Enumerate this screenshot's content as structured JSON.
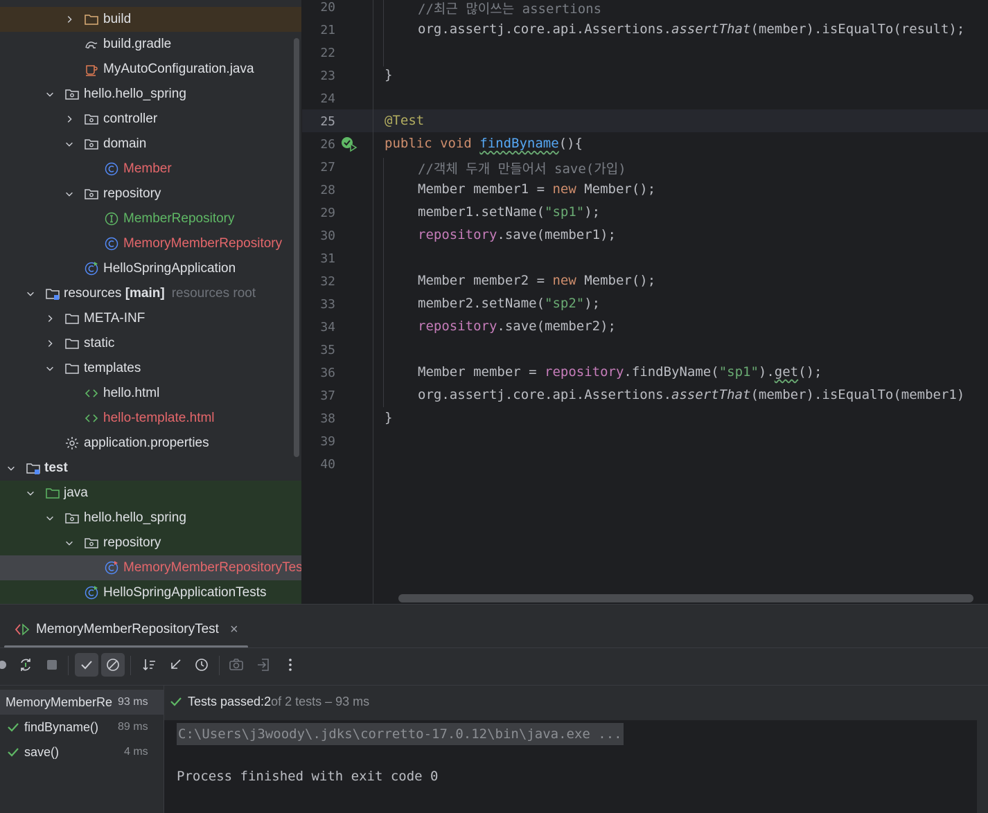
{
  "project_tree": {
    "items": [
      {
        "label": "build",
        "expanded": false
      },
      {
        "label": "build.gradle"
      },
      {
        "label": "MyAutoConfiguration.java"
      },
      {
        "label": "hello.hello_spring",
        "expanded": true
      },
      {
        "label": "controller",
        "expanded": false
      },
      {
        "label": "domain",
        "expanded": true
      },
      {
        "label": "Member"
      },
      {
        "label": "repository",
        "expanded": true
      },
      {
        "label": "MemberRepository"
      },
      {
        "label": "MemoryMemberRepository"
      },
      {
        "label": "HelloSpringApplication"
      },
      {
        "label": "resources",
        "tag": "[main]",
        "hint": "resources root",
        "expanded": true
      },
      {
        "label": "META-INF",
        "expanded": false
      },
      {
        "label": "static",
        "expanded": false
      },
      {
        "label": "templates",
        "expanded": true
      },
      {
        "label": "hello.html"
      },
      {
        "label": "hello-template.html"
      },
      {
        "label": "application.properties"
      },
      {
        "label": "test",
        "expanded": true
      },
      {
        "label": "java",
        "expanded": true
      },
      {
        "label": "hello.hello_spring",
        "expanded": true
      },
      {
        "label": "repository",
        "expanded": true
      },
      {
        "label": "MemoryMemberRepositoryTest",
        "selected": true
      },
      {
        "label": "HelloSpringApplicationTests"
      }
    ]
  },
  "editor": {
    "line_numbers": [
      "20",
      "21",
      "22",
      "23",
      "24",
      "25",
      "26",
      "27",
      "28",
      "29",
      "30",
      "31",
      "32",
      "33",
      "34",
      "35",
      "36",
      "37",
      "38",
      "39",
      "40"
    ],
    "active_line": "25",
    "lines": {
      "l20": {
        "comment": "//최근 많이쓰는 assertions"
      },
      "l21": {
        "a": "org.assertj.core.api.Assertions.",
        "b": "assertThat",
        "c": "(member).isEqualTo(result);"
      },
      "l23": {
        "brace": "}"
      },
      "l25": {
        "annotation": "@Test"
      },
      "l26": {
        "kw": "public void ",
        "fn": "findByname",
        "rest": "(){"
      },
      "l27": {
        "comment": "//객체 두개 만들어서 save(가입)"
      },
      "l28": {
        "a": "Member member1 = ",
        "kw": "new",
        "b": " Member();"
      },
      "l29": {
        "a": "member1.setName(",
        "str": "\"sp1\"",
        "b": ");"
      },
      "l30": {
        "fld": "repository",
        "b": ".save(member1);"
      },
      "l32": {
        "a": "Member member2 = ",
        "kw": "new",
        "b": " Member();"
      },
      "l33": {
        "a": "member2.setName(",
        "str": "\"sp2\"",
        "b": ");"
      },
      "l34": {
        "fld": "repository",
        "b": ".save(member2);"
      },
      "l36": {
        "a": "Member member = ",
        "fld": "repository",
        "b": ".findByName(",
        "str": "\"sp1\"",
        "c": ").",
        "d": "get",
        "e": "();"
      },
      "l37": {
        "a": "org.assertj.core.api.Assertions.",
        "b": "assertThat",
        "c": "(member).isEqualTo(member1)"
      },
      "l38": {
        "brace": "}"
      }
    }
  },
  "run_window": {
    "tab_label": "MemoryMemberRepositoryTest",
    "close_glyph": "×",
    "results": [
      {
        "name": "MemoryMemberRe",
        "time": "93 ms"
      },
      {
        "name": "findByname()",
        "time": "89 ms"
      },
      {
        "name": "save()",
        "time": "4 ms"
      }
    ],
    "status": {
      "prefix": "Tests passed: ",
      "passed": "2",
      "suffix": " of 2 tests – 93 ms"
    },
    "console": {
      "command": "C:\\Users\\j3woody\\.jdks\\corretto-17.0.12\\bin\\java.exe ...",
      "exit": "Process finished with exit code 0"
    }
  },
  "colors": {
    "editor_bg": "#1e1f22",
    "panel_bg": "#2b2d30",
    "keyword": "#cf8e6d",
    "function": "#56a8f5",
    "string": "#6aab73",
    "field": "#c77dbb",
    "annotation": "#b3ae60",
    "error_class": "#e5676b",
    "pass_green": "#5fb865"
  }
}
